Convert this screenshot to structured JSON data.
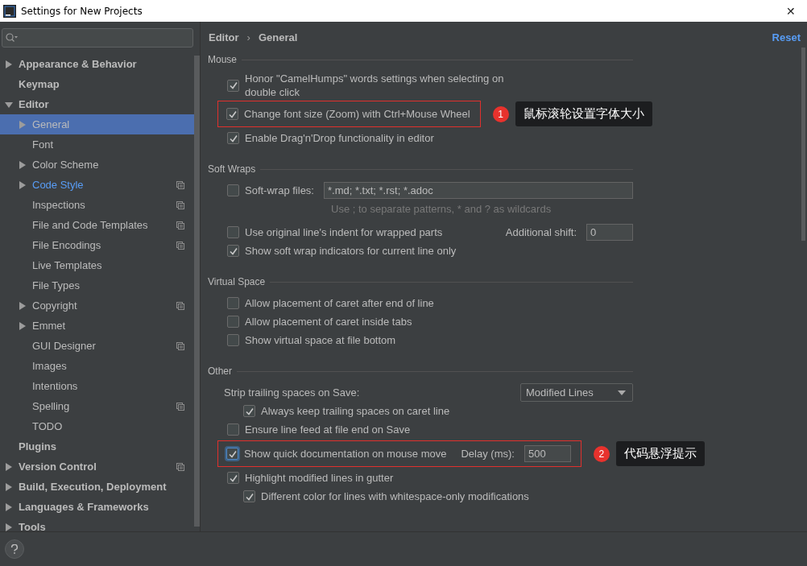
{
  "window": {
    "title": "Settings for New Projects",
    "close": "✕"
  },
  "sidebar": {
    "items": [
      {
        "label": "Appearance & Behavior",
        "expanded": false
      },
      {
        "label": "Keymap"
      },
      {
        "label": "Editor",
        "expanded": true,
        "children": [
          {
            "label": "General",
            "expanded": false,
            "selected": true
          },
          {
            "label": "Font",
            "selected": false
          },
          {
            "label": "Color Scheme",
            "expanded": false,
            "selected": false
          },
          {
            "label": "Code Style",
            "expanded": false,
            "selected": false,
            "modified": true,
            "project_scope": true
          },
          {
            "label": "Inspections",
            "selected": false,
            "project_scope": true
          },
          {
            "label": "File and Code Templates",
            "selected": false,
            "project_scope": true
          },
          {
            "label": "File Encodings",
            "selected": false,
            "project_scope": true
          },
          {
            "label": "Live Templates",
            "selected": false
          },
          {
            "label": "File Types",
            "selected": false
          },
          {
            "label": "Copyright",
            "expanded": false,
            "selected": false,
            "project_scope": true
          },
          {
            "label": "Emmet",
            "expanded": false,
            "selected": false
          },
          {
            "label": "GUI Designer",
            "selected": false,
            "project_scope": true
          },
          {
            "label": "Images",
            "selected": false
          },
          {
            "label": "Intentions",
            "selected": false
          },
          {
            "label": "Spelling",
            "selected": false,
            "project_scope": true
          },
          {
            "label": "TODO",
            "selected": false
          }
        ]
      },
      {
        "label": "Plugins"
      },
      {
        "label": "Version Control",
        "expanded": false,
        "project_scope": true
      },
      {
        "label": "Build, Execution, Deployment",
        "expanded": false
      },
      {
        "label": "Languages & Frameworks",
        "expanded": false
      },
      {
        "label": "Tools",
        "expanded": false
      }
    ]
  },
  "breadcrumb": {
    "items": [
      "Editor",
      "General"
    ],
    "separator": "›"
  },
  "reset": "Reset",
  "sections": [
    {
      "title": "Mouse",
      "rows": [
        {
          "kind": "checkbox",
          "label": "Honor \"CamelHumps\" words settings when selecting on double click",
          "checked": true
        },
        {
          "kind": "checkbox",
          "label": "Change font size (Zoom) with Ctrl+Mouse Wheel",
          "checked": true,
          "highlighted": true,
          "annotation": {
            "number": "1",
            "text": "鼠标滚轮设置字体大小"
          }
        },
        {
          "kind": "checkbox",
          "label": "Enable Drag'n'Drop functionality in editor",
          "checked": true
        }
      ]
    },
    {
      "title": "Soft Wraps",
      "rows": [
        {
          "kind": "checkbox",
          "label": "Soft-wrap files:",
          "checked": false,
          "field": {
            "value": "*.md; *.txt; *.rst; *.adoc"
          },
          "hint": "Use ; to separate patterns, * and ? as wildcards"
        },
        {
          "kind": "checkbox",
          "label": "Use original line's indent for wrapped parts",
          "checked": false,
          "field": {
            "label": "Additional shift:",
            "value": "0"
          }
        },
        {
          "kind": "checkbox",
          "label": "Show soft wrap indicators for current line only",
          "checked": true
        }
      ]
    },
    {
      "title": "Virtual Space",
      "rows": [
        {
          "kind": "checkbox",
          "label": "Allow placement of caret after end of line",
          "checked": false
        },
        {
          "kind": "checkbox",
          "label": "Allow placement of caret inside tabs",
          "checked": false
        },
        {
          "kind": "checkbox",
          "label": "Show virtual space at file bottom",
          "checked": false
        }
      ]
    },
    {
      "title": "Other",
      "rows": [
        {
          "kind": "dropdown",
          "label": "Strip trailing spaces on Save:",
          "value": "Modified Lines",
          "children": [
            {
              "kind": "checkbox",
              "label": "Always keep trailing spaces on caret line",
              "checked": true
            }
          ]
        },
        {
          "kind": "checkbox",
          "label": "Ensure line feed at file end on Save",
          "checked": false
        },
        {
          "kind": "checkbox",
          "label": "Show quick documentation on mouse move",
          "checked": true,
          "focused": true,
          "highlighted": true,
          "field": {
            "label": "Delay (ms):",
            "value": "500"
          },
          "annotation": {
            "number": "2",
            "text": "代码悬浮提示"
          }
        },
        {
          "kind": "checkbox",
          "label": "Highlight modified lines in gutter",
          "checked": true,
          "children": [
            {
              "kind": "checkbox",
              "label": "Different color for lines with whitespace-only modifications",
              "checked": true
            }
          ]
        }
      ]
    }
  ]
}
